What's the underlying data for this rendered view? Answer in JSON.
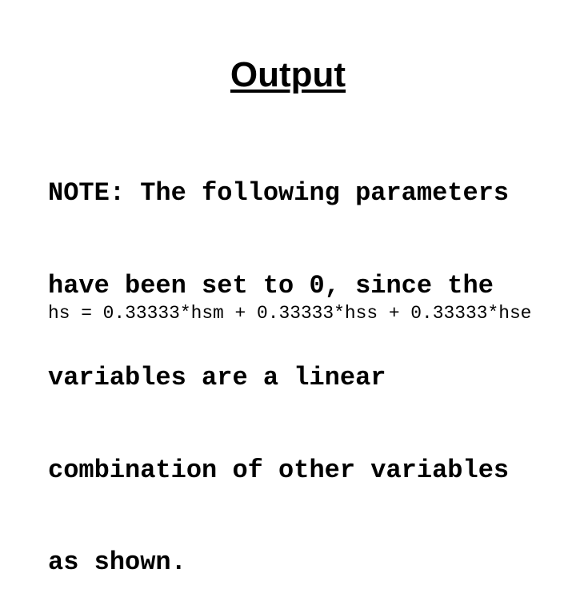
{
  "slide": {
    "title": "Output",
    "note_lines": [
      "NOTE: The following parameters",
      "have been set to 0, since the",
      "variables are a linear",
      "combination of other variables",
      "as shown."
    ],
    "equation": "hs = 0.33333*hsm + 0.33333*hss + 0.33333*hse"
  }
}
